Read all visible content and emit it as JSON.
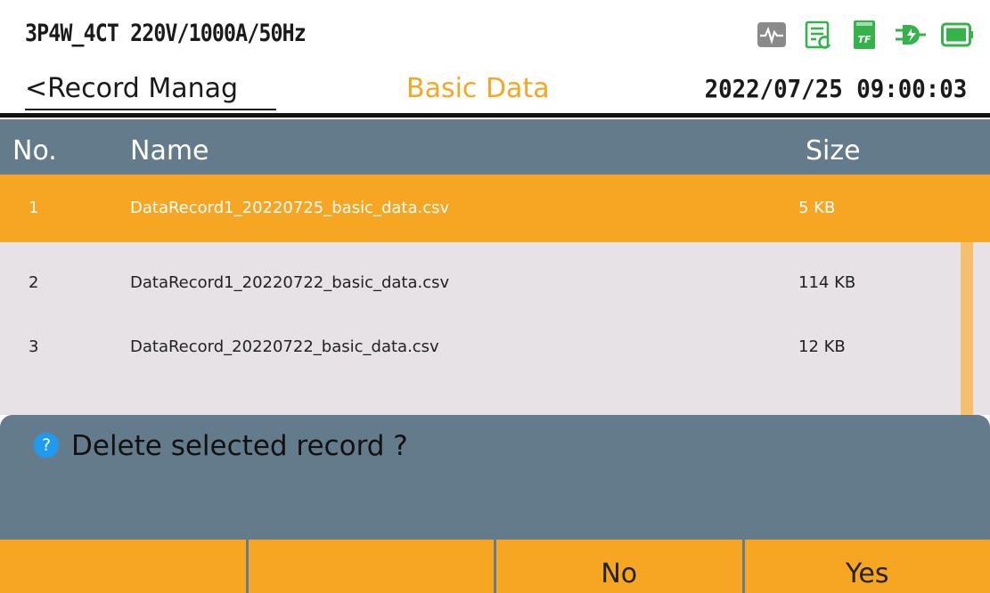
{
  "header": {
    "config": "3P4W_4CT 220V/1000A/50Hz",
    "back_label": "<Record Manag",
    "title": "Basic Data",
    "datetime": "2022/07/25 09:00:03",
    "status_icons": [
      "waveform-icon",
      "record-icon",
      "tf-card-icon",
      "power-plug-icon",
      "battery-icon"
    ],
    "tf_label": "TF"
  },
  "table": {
    "headers": {
      "no": "No.",
      "name": "Name",
      "size": "Size"
    },
    "rows": [
      {
        "no": "1",
        "name": "DataRecord1_20220725_basic_data.csv",
        "size": "5 KB",
        "selected": true
      },
      {
        "no": "2",
        "name": "DataRecord1_20220722_basic_data.csv",
        "size": "114 KB",
        "selected": false
      },
      {
        "no": "3",
        "name": "DataRecord_20220722_basic_data.csv",
        "size": "12 KB",
        "selected": false
      }
    ]
  },
  "dialog": {
    "icon": "question-icon",
    "icon_glyph": "?",
    "message": "Delete selected record ?",
    "buttons": [
      "",
      "",
      "No",
      "Yes"
    ]
  },
  "colors": {
    "accent": "#f6a623",
    "header_bar": "#637b8a",
    "list_bg": "#e6e2e6",
    "status_green": "#35b24a",
    "status_gray": "#8a8a8a",
    "info_blue": "#1e9bf0"
  }
}
